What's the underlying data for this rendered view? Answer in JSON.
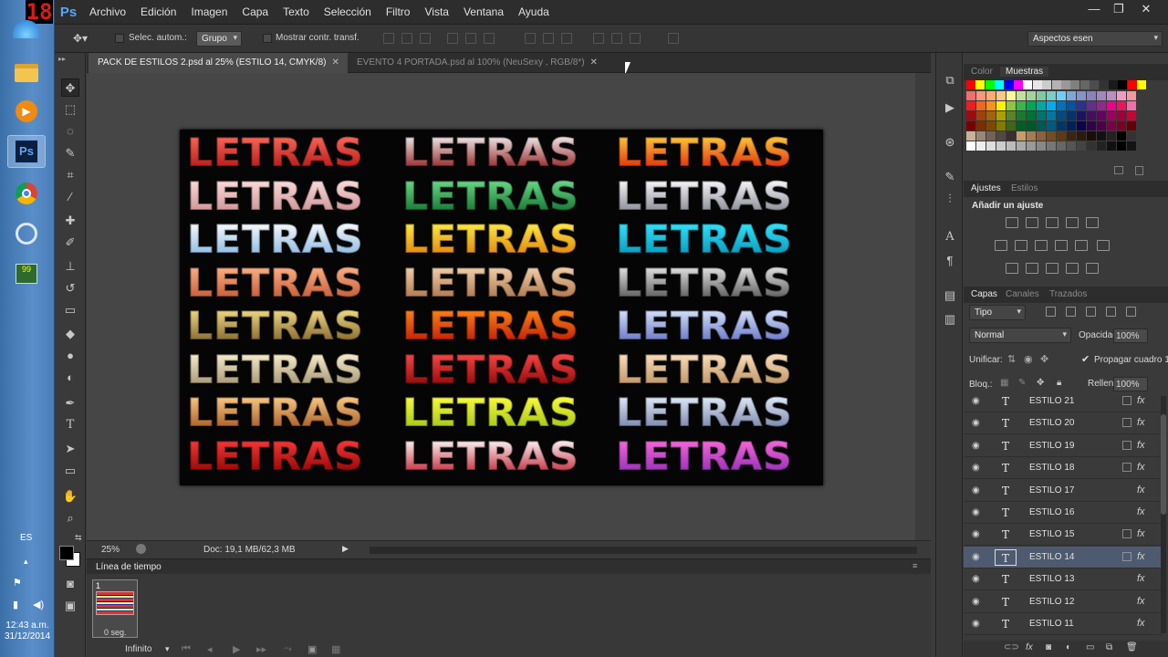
{
  "taskbar": {
    "badge": "18",
    "clock_time": "12:43 a.m.",
    "clock_date": "31/12/2014",
    "lang": "ES",
    "ps_label": "Ps"
  },
  "app": {
    "logo": "Ps",
    "menus": [
      "Archivo",
      "Edición",
      "Imagen",
      "Capa",
      "Texto",
      "Selección",
      "Filtro",
      "Vista",
      "Ventana",
      "Ayuda"
    ]
  },
  "options": {
    "auto_select": "Selec. autom.:",
    "group_value": "Grupo",
    "show_transform": "Mostrar contr. transf.",
    "workspace": "Aspectos esen"
  },
  "tabs": [
    {
      "label": "PACK DE ESTILOS 2.psd al 25% (ESTILO 14, CMYK/8)",
      "active": true
    },
    {
      "label": "EVENTO 4 PORTADA.psd al 100% (NeuSexy , RGB/8*)",
      "active": false
    }
  ],
  "canvas": {
    "word": "LETRAS"
  },
  "status": {
    "zoom": "25%",
    "doc": "Doc: 19,1 MB/62,3 MB"
  },
  "timeline": {
    "title": "Línea de tiempo",
    "frame_number": "1",
    "frame_delay": "0 seg.",
    "loop": "Infinito"
  },
  "color_panel": {
    "tab_color": "Color",
    "tab_swatches": "Muestras"
  },
  "adjust_panel": {
    "tab_adjust": "Ajustes",
    "tab_styles": "Estilos",
    "heading": "Añadir un ajuste"
  },
  "layers_panel": {
    "tab_layers": "Capas",
    "tab_channels": "Canales",
    "tab_paths": "Trazados",
    "kind": "Tipo",
    "blend_mode": "Normal",
    "opacity_label": "Opacidad:",
    "opacity_value": "100%",
    "unify_label": "Unificar:",
    "propagate_label": "Propagar cuadro 1",
    "lock_label": "Bloq.:",
    "fill_label": "Relleno:",
    "fill_value": "100%",
    "layers": [
      {
        "name": "ESTILO 21",
        "selected": false,
        "link": true
      },
      {
        "name": "ESTILO 20",
        "selected": false,
        "link": true
      },
      {
        "name": "ESTILO 19",
        "selected": false,
        "link": true
      },
      {
        "name": "ESTILO 18",
        "selected": false,
        "link": true
      },
      {
        "name": "ESTILO 17",
        "selected": false,
        "link": false
      },
      {
        "name": "ESTILO 16",
        "selected": false,
        "link": false
      },
      {
        "name": "ESTILO 15",
        "selected": false,
        "link": true
      },
      {
        "name": "ESTILO 14",
        "selected": true,
        "link": true
      },
      {
        "name": "ESTILO 13",
        "selected": false,
        "link": false
      },
      {
        "name": "ESTILO 12",
        "selected": false,
        "link": false
      },
      {
        "name": "ESTILO 11",
        "selected": false,
        "link": false
      }
    ],
    "fx_label": "fx"
  }
}
